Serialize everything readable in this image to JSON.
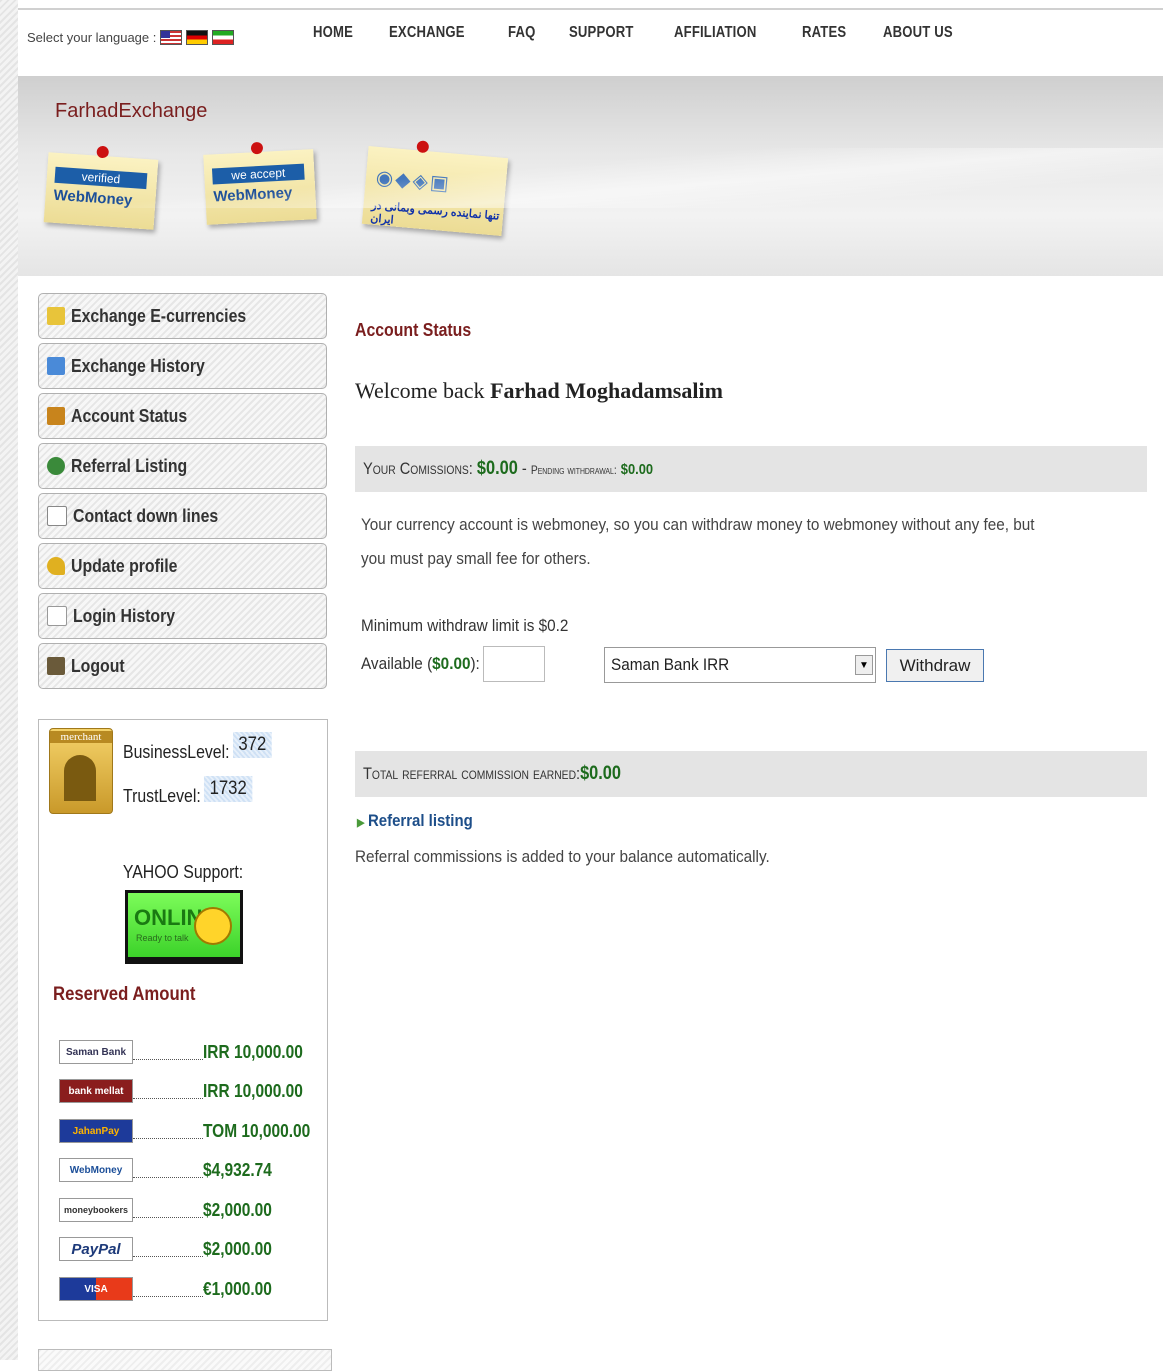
{
  "topbar": {
    "language_label": "Select your language :",
    "flags": [
      "flag-us-icon",
      "flag-de-icon",
      "flag-ir-icon"
    ],
    "nav": [
      "HOME",
      "EXCHANGE",
      "FAQ",
      "SUPPORT",
      "AFFILIATION",
      "RATES",
      "ABOUT US"
    ]
  },
  "header": {
    "site_title": "FarhadExchange",
    "badges": [
      {
        "banner": "verified",
        "brand": "WebMoney"
      },
      {
        "banner": "we accept",
        "brand": "WebMoney"
      },
      {
        "text": "تنها نماینده رسمی وبمانی در ایران"
      }
    ]
  },
  "sidebar": {
    "menu": [
      {
        "label": "Exchange E-currencies",
        "icon": "exchange-icon",
        "color": "#e8c43a"
      },
      {
        "label": "Exchange History",
        "icon": "edit-icon",
        "color": "#4a8ad8"
      },
      {
        "label": "Account Status",
        "icon": "home-icon",
        "color": "#c8841c"
      },
      {
        "label": "Referral Listing",
        "icon": "user-icon",
        "color": "#3a8a3a"
      },
      {
        "label": "Contact down lines",
        "icon": "sitemap-icon",
        "color": "#888888"
      },
      {
        "label": "Update profile",
        "icon": "key-icon",
        "color": "#e0b020"
      },
      {
        "label": "Login History",
        "icon": "document-icon",
        "color": "#999999"
      },
      {
        "label": "Logout",
        "icon": "exit-icon",
        "color": "#6a5a3a"
      }
    ],
    "merchant_label": "merchant",
    "business_level_label": "BusinessLevel:",
    "business_level": "372",
    "trust_level_label": "TrustLevel:",
    "trust_level": "1732",
    "yahoo_title": "YAHOO Support:",
    "yahoo_status": "ONLINE",
    "yahoo_sub": "Ready to talk",
    "reserved_title": "Reserved Amount",
    "reserved": [
      {
        "logo": "Saman Bank",
        "value": "IRR 10,000.00"
      },
      {
        "logo": "bank mellat",
        "value": "IRR 10,000.00"
      },
      {
        "logo": "JahanPay",
        "value": "TOM 10,000.00"
      },
      {
        "logo": "WebMoney",
        "value": "$4,932.74"
      },
      {
        "logo": "moneybookers",
        "value": "$2,000.00"
      },
      {
        "logo": "PayPal",
        "value": "$2,000.00"
      },
      {
        "logo": "VISA",
        "value": "€1,000.00"
      }
    ]
  },
  "main": {
    "section_title": "Account Status",
    "welcome_prefix": "Welcome back",
    "user_name": "Farhad Moghadamsalim",
    "commissions_label": "Your Comissions:",
    "commissions_value": "$0.00",
    "pending_label": "Pending withdrawal:",
    "pending_value": "$0.00",
    "info_text": "Your currency account is webmoney, so you can withdraw money to webmoney without any fee, but you must pay small fee for others.",
    "min_limit": "Minimum withdraw limit is $0.2",
    "available_prefix": "Available (",
    "available_value": "$0.00",
    "available_suffix": "):",
    "amount_value": "",
    "withdraw_method": "Saman Bank IRR",
    "withdraw_button": "Withdraw",
    "total_label": "Total referral commission earned:",
    "total_value": "$0.00",
    "referral_link": "Referral listing",
    "referral_note": "Referral commissions is added to your balance automatically."
  }
}
